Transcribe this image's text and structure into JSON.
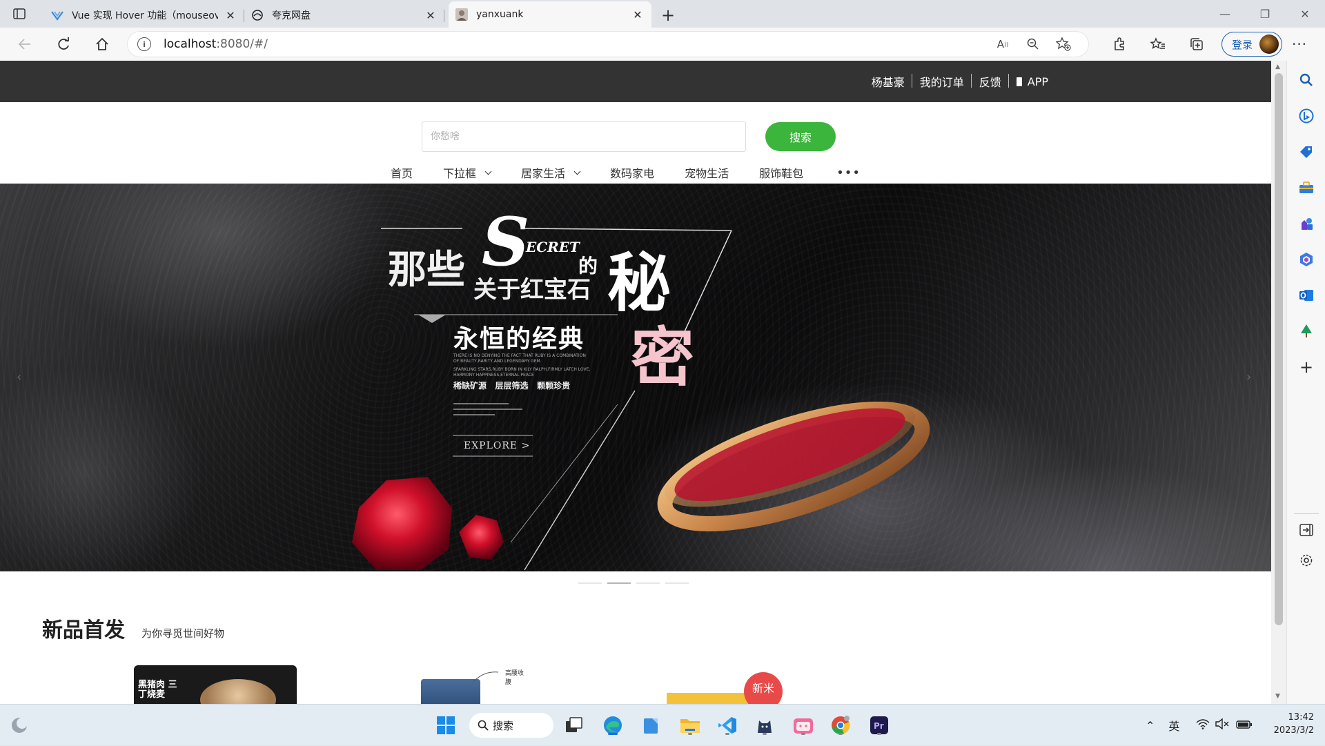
{
  "browser": {
    "tabs": [
      {
        "title": "Vue 实现 Hover 功能（mouseov",
        "favicon": "vue-logo-icon",
        "active": false
      },
      {
        "title": "夸克网盘",
        "favicon": "quark-cloud-icon",
        "active": false
      },
      {
        "title": "yanxuank",
        "favicon": "portrait-icon",
        "active": true
      }
    ],
    "url_host": "localhost",
    "url_rest": ":8080/#/",
    "login_label": "登录"
  },
  "page": {
    "topbar": {
      "links": [
        "杨基豪",
        "我的订单",
        "反馈",
        "APP"
      ]
    },
    "search": {
      "placeholder": "你愁啥",
      "button": "搜索"
    },
    "nav": [
      {
        "label": "首页",
        "dropdown": false
      },
      {
        "label": "下拉框",
        "dropdown": true
      },
      {
        "label": "居家生活",
        "dropdown": true
      },
      {
        "label": "数码家电",
        "dropdown": false
      },
      {
        "label": "宠物生活",
        "dropdown": false
      },
      {
        "label": "服饰鞋包",
        "dropdown": false
      }
    ],
    "nav_more": "•••",
    "banner": {
      "line1": "那些",
      "s_letter": "S",
      "ecret": "ECRET",
      "de": "的",
      "line2": "关于红宝石",
      "mi": "秘",
      "mi2": "密",
      "classic": "永恒的经典",
      "small1": "THERE IS NO DENYING THE FACT THAT RUBY IS A COMBINATION",
      "small2": "OF BEAUTY,RARITY,AND LEGENDARY GEM.",
      "small3": "SPARKLING STARS,RUBY BORN IN KILY RALPH,FIRMLY LATCH LOVE,",
      "small4": "HARMONY HAPPINESS,ETERNAL PEACE",
      "tags": "稀缺矿源   层层筛选   颗颗珍贵",
      "explore": "EXPLORE >",
      "slides_total": 4,
      "active_slide": 2
    },
    "section": {
      "title": "新品首发",
      "subtitle": "为你寻觅世间好物"
    },
    "products": {
      "p1_label": "黑猪肉 三丁烧麦",
      "p2_label": "高腰收腹",
      "p3_badge": "新米"
    }
  },
  "taskbar": {
    "search_label": "搜索",
    "ime": "英",
    "time": "13:42",
    "date": "2023/3/2"
  }
}
